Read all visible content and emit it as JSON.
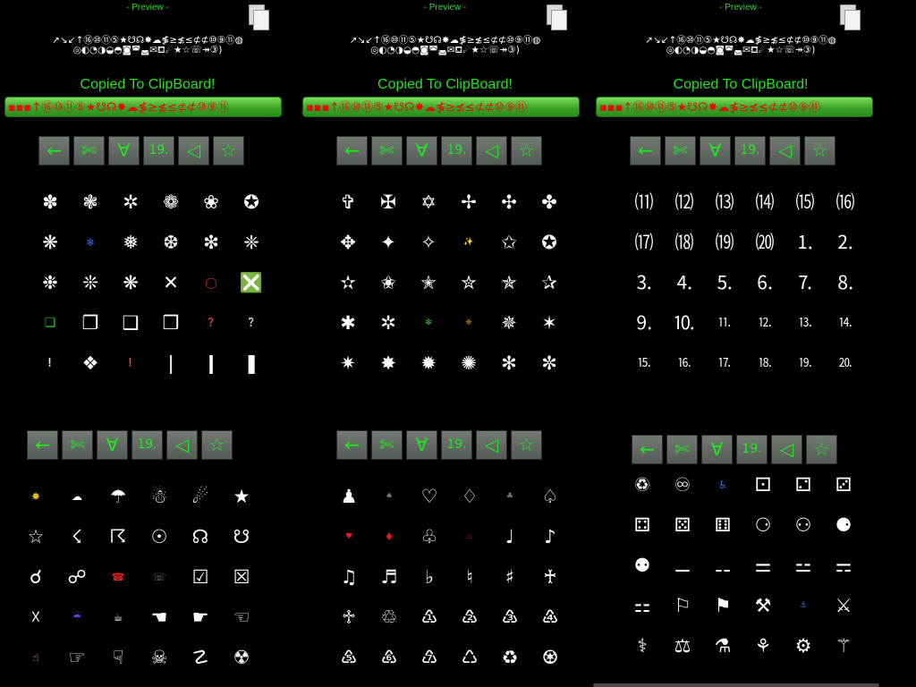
{
  "preview": {
    "title": "- Preview -",
    "line1": "↗↘↙↑⑯⑩⑪⑤★☋☊✸☁≸≥≴≤⊄⊄⑩⑨⑪◍",
    "line2": "◎◐◔◑◒◓◙◚◛✉⛾☄★☆☏↠③)",
    "copied": "Copied To ClipBoard!",
    "bar": "▪▪▪↑⑯⑩⑪⑤★☋☊✸☁≸≥≴≤⊄⊄⑩⑨⑪"
  },
  "toolbar": {
    "back": "←",
    "scissors": "✄",
    "forall": "∀",
    "nineteen": "19.",
    "triangle": "◁",
    "star": "☆"
  },
  "grids": {
    "p1_top": [
      "✽",
      "❃",
      "✲",
      "❁",
      "❀",
      "✪",
      "❋",
      "❄",
      "❅",
      "❆",
      "❇",
      "❈",
      "❉",
      "❊",
      "❋",
      "✕",
      "◯",
      "❎",
      "❏",
      "❐",
      "❑",
      "❒",
      "❓",
      "❔",
      "❕",
      "❖",
      "❗",
      "❘",
      "❙",
      "❚"
    ],
    "p2_top": [
      "✞",
      "✠",
      "✡",
      "✢",
      "✣",
      "✤",
      "✥",
      "✦",
      "✧",
      "✨",
      "✩",
      "✪",
      "✫",
      "✬",
      "✭",
      "✮",
      "✯",
      "✰",
      "✱",
      "✲",
      "❇",
      "❈",
      "✵",
      "✶",
      "✷",
      "✸",
      "✹",
      "✺",
      "✻",
      "✼"
    ],
    "p3_top": [
      "⑾",
      "⑿",
      "⒀",
      "⒁",
      "⒂",
      "⒃",
      "⒄",
      "⒅",
      "⒆",
      "⒇",
      "⒈",
      "⒉",
      "⒊",
      "⒋",
      "⒌",
      "⒍",
      "⒎",
      "⒏",
      "⒐",
      "⒑",
      "⒒",
      "⒓",
      "⒔",
      "⒕",
      "⒖",
      "⒗",
      "⒘",
      "⒙",
      "⒚",
      "⒛"
    ],
    "p1_bottom": [
      "✸",
      "☁",
      "☂",
      "☃",
      "☄",
      "★",
      "☆",
      "☇",
      "☈",
      "☉",
      "☊",
      "☋",
      "☌",
      "☍",
      "☎",
      "☏",
      "☑",
      "☒",
      "☓",
      "☔",
      "☕",
      "☚",
      "☛",
      "☜",
      "☝",
      "☞",
      "☟",
      "☠",
      "☡",
      "☢"
    ],
    "p2_bottom": [
      "♟",
      "♠",
      "♡",
      "♢",
      "♣",
      "♤",
      "♥",
      "♦",
      "♧",
      "♨",
      "♩",
      "♪",
      "♫",
      "♬",
      "♭",
      "♮",
      "♯",
      "♰",
      "♱",
      "♲",
      "♳",
      "♴",
      "♵",
      "♶",
      "♷",
      "♸",
      "♹",
      "♺",
      "♻",
      "♼"
    ],
    "p3_bottom": [
      "♽",
      "♾",
      "♿",
      "⚀",
      "⚁",
      "⚂",
      "⚃",
      "⚄",
      "⚅",
      "⚆",
      "⚇",
      "⚈",
      "⚉",
      "⚊",
      "⚋",
      "⚌",
      "⚍",
      "⚎",
      "⚏",
      "⚐",
      "⚑",
      "⚒",
      "⚓",
      "⚔",
      "⚕",
      "⚖",
      "⚗",
      "⚘",
      "⚙",
      "⚚"
    ]
  },
  "colors": {
    "accent_green": "#22e622",
    "glyph_white": "#ffffff",
    "bar_red": "#e01010"
  }
}
